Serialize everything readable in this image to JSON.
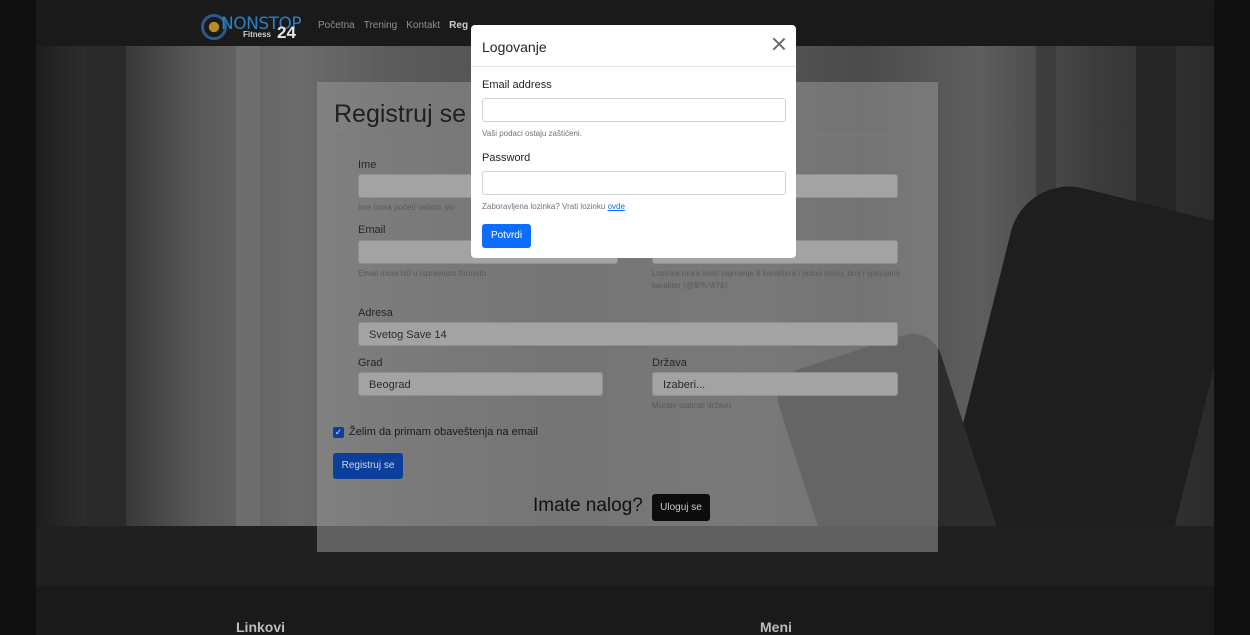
{
  "brand": {
    "logo_word": "NONSTOP",
    "logo_sub": "Fitness",
    "logo_num": "24"
  },
  "nav": {
    "items": [
      "Početna",
      "Trening",
      "Kontakt",
      "Reg"
    ]
  },
  "form": {
    "title": "Registruj se",
    "name": {
      "label": "Ime",
      "help": "Ime mora početi velikim slo"
    },
    "email": {
      "label": "Email",
      "help": "Email mora biti u ispravnom formatu"
    },
    "password_help": "Lozinka mora imati najmanje 8 karaktera i jedno slovo, broj i specijalni karakter (@$!%*#?&)",
    "address": {
      "label": "Adresa",
      "value": "Svetog Save 14"
    },
    "city": {
      "label": "Grad",
      "value": "Beograd"
    },
    "country": {
      "label": "Država",
      "value": "Izaberi...",
      "help": "Morate izabrati državu"
    },
    "newsletter_label": "Želim da primam obaveštenja na email",
    "submit_label": "Registruj se",
    "have_account": "Imate nalog?",
    "login_label": "Uloguj se"
  },
  "modal": {
    "title": "Logovanje",
    "email_label": "Email address",
    "email_help": "Vaši podaci ostaju zaštićeni.",
    "password_label": "Password",
    "forgot_text": "Zaboravljena lozinka? Vrati lozinku",
    "forgot_link": "ovde",
    "submit_label": "Potvrdi"
  },
  "footer": {
    "links_heading": "Linkovi",
    "menu_heading": "Meni"
  },
  "colors": {
    "primary": "#0d6efd",
    "navbar": "#1a1a1a"
  }
}
